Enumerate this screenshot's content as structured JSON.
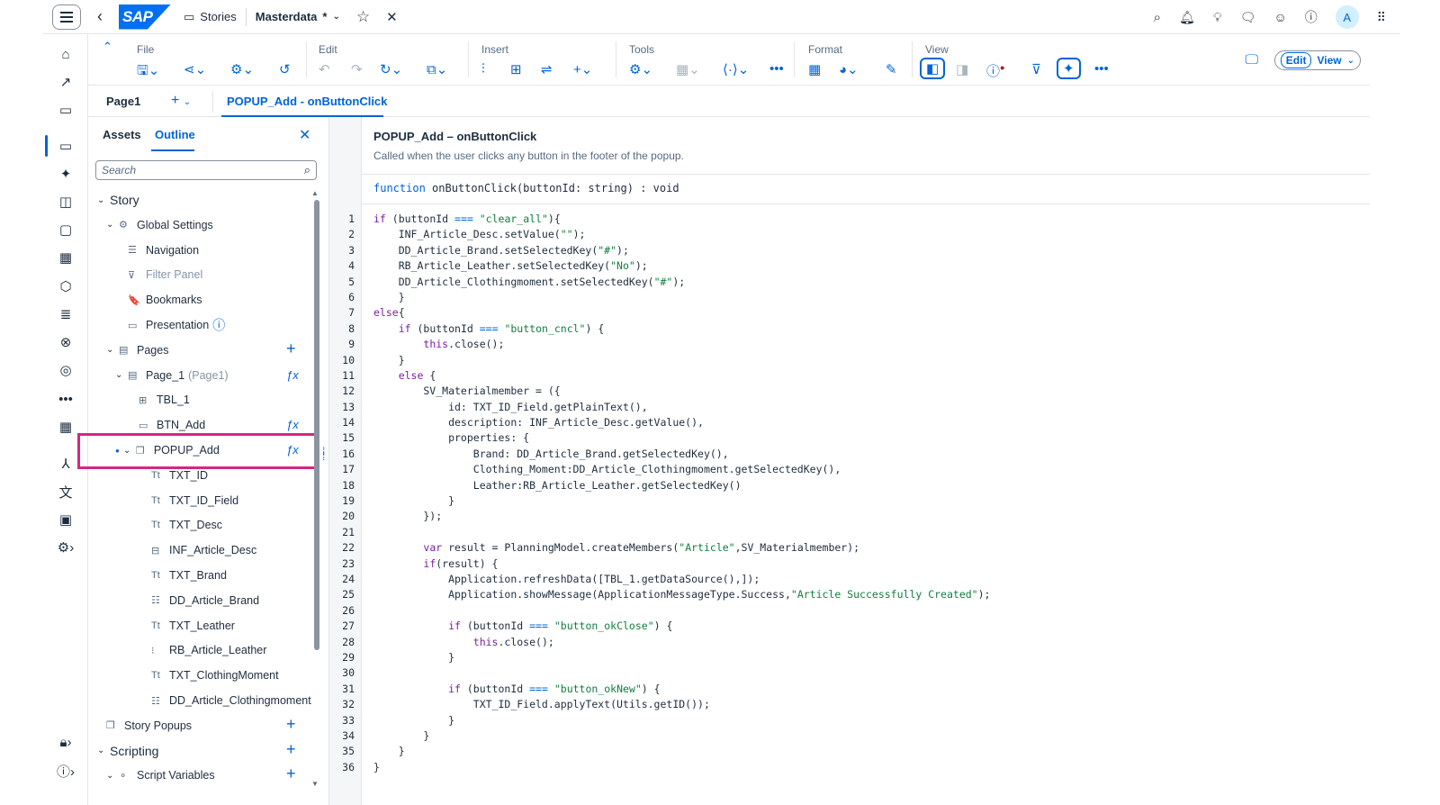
{
  "shell": {
    "app": "Stories",
    "document": "Masterdata",
    "modified_marker": "*",
    "avatar_initial": "A"
  },
  "toolbar": {
    "groups": [
      "File",
      "Edit",
      "Insert",
      "Tools",
      "Format",
      "View"
    ],
    "edit_label": "Edit",
    "view_label": "View"
  },
  "tabs": {
    "page": "Page1",
    "active": "POPUP_Add - onButtonClick"
  },
  "panel": {
    "tab_assets": "Assets",
    "tab_outline": "Outline",
    "search_placeholder": "Search",
    "tree": [
      {
        "label": "Story",
        "level": 0,
        "chevron": "⌄"
      },
      {
        "label": "Global Settings",
        "level": 1,
        "chevron": "⌄",
        "icon": "⚙"
      },
      {
        "label": "Navigation",
        "level": 2,
        "icon": "☰"
      },
      {
        "label": "Filter Panel",
        "level": 2,
        "icon": "⊽",
        "muted": true
      },
      {
        "label": "Bookmarks",
        "level": 2,
        "icon": "🔖"
      },
      {
        "label": "Presentation",
        "level": 2,
        "icon": "▭",
        "info": true
      },
      {
        "label": "Pages",
        "level": 1,
        "chevron": "⌄",
        "icon": "▤",
        "action": "+"
      },
      {
        "label": "Page_1",
        "sub": "(Page1)",
        "level": 2,
        "chevron": "⌄",
        "icon": "▤",
        "action": "fx"
      },
      {
        "label": "TBL_1",
        "level": 3,
        "icon": "⊞"
      },
      {
        "label": "BTN_Add",
        "level": 3,
        "icon": "▭",
        "action": "fx"
      },
      {
        "label": "POPUP_Add",
        "level": 3,
        "chevron": "⌄",
        "icon": "❐",
        "action": "fx",
        "dot": true
      },
      {
        "label": "TXT_ID",
        "level": 4,
        "icon": "Tt"
      },
      {
        "label": "TXT_ID_Field",
        "level": 4,
        "icon": "Tt"
      },
      {
        "label": "TXT_Desc",
        "level": 4,
        "icon": "Tt"
      },
      {
        "label": "INF_Article_Desc",
        "level": 4,
        "icon": "⊟"
      },
      {
        "label": "TXT_Brand",
        "level": 4,
        "icon": "Tt"
      },
      {
        "label": "DD_Article_Brand",
        "level": 4,
        "icon": "☷"
      },
      {
        "label": "TXT_Leather",
        "level": 4,
        "icon": "Tt"
      },
      {
        "label": "RB_Article_Leather",
        "level": 4,
        "icon": "⁝"
      },
      {
        "label": "TXT_ClothingMoment",
        "level": 4,
        "icon": "Tt"
      },
      {
        "label": "DD_Article_Clothingmoment",
        "level": 4,
        "icon": "☷"
      },
      {
        "label": "Story Popups",
        "level": 1,
        "icon": "❐",
        "action": "+"
      },
      {
        "label": "Scripting",
        "level": 0,
        "chevron": "⌄",
        "action": "+"
      },
      {
        "label": "Script Variables",
        "level": 1,
        "chevron": "⌄",
        "icon": "⚬",
        "action": "+"
      }
    ]
  },
  "editor": {
    "title": "POPUP_Add – onButtonClick",
    "description": "Called when the user clicks any button in the footer of the popup.",
    "signature": "function onButtonClick(buttonId: string) : void",
    "lines": [
      "if (buttonId === \"clear_all\"){",
      "    INF_Article_Desc.setValue(\"\");",
      "    DD_Article_Brand.setSelectedKey(\"#\");",
      "    RB_Article_Leather.setSelectedKey(\"No\");",
      "    DD_Article_Clothingmoment.setSelectedKey(\"#\");",
      "    }",
      "else{",
      "    if (buttonId === \"button_cncl\") {",
      "        this.close();",
      "    }",
      "    else {",
      "        SV_Materialmember = ({",
      "            id: TXT_ID_Field.getPlainText(),",
      "            description: INF_Article_Desc.getValue(),",
      "            properties: {",
      "                Brand: DD_Article_Brand.getSelectedKey(),",
      "                Clothing_Moment:DD_Article_Clothingmoment.getSelectedKey(),",
      "                Leather:RB_Article_Leather.getSelectedKey()",
      "            }",
      "        });",
      "",
      "        var result = PlanningModel.createMembers(\"Article\",SV_Materialmember);",
      "        if(result) {",
      "            Application.refreshData([TBL_1.getDataSource(),]);",
      "            Application.showMessage(ApplicationMessageType.Success,\"Article Successfully Created\");",
      "",
      "            if (buttonId === \"button_okClose\") {",
      "                this.close();",
      "            }",
      "",
      "            if (buttonId === \"button_okNew\") {",
      "                TXT_ID_Field.applyText(Utils.getID());",
      "            }",
      "        }",
      "    }",
      "}"
    ]
  },
  "colors": {
    "accent": "#0064d9",
    "highlight_box": "#d6277f",
    "keyword": "#7b1fa2",
    "string": "#107e3e"
  }
}
